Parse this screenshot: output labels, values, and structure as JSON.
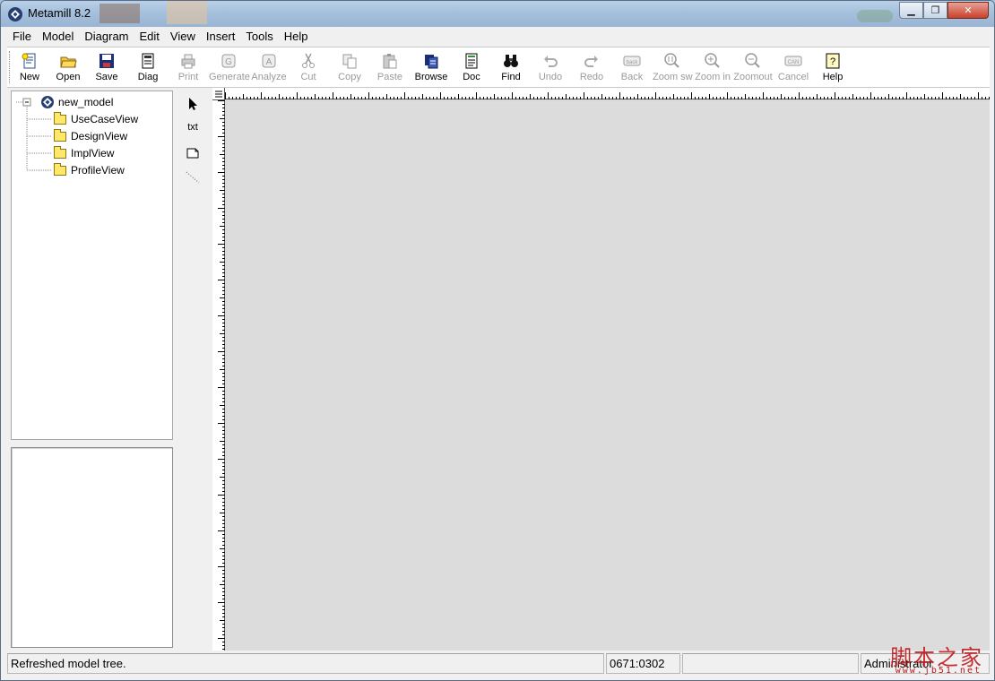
{
  "window": {
    "title": "Metamill 8.2"
  },
  "menu": [
    "File",
    "Model",
    "Diagram",
    "Edit",
    "View",
    "Insert",
    "Tools",
    "Help"
  ],
  "toolbar": [
    {
      "label": "New",
      "icon": "new-document-icon",
      "enabled": true
    },
    {
      "label": "Open",
      "icon": "open-folder-icon",
      "enabled": true
    },
    {
      "label": "Save",
      "icon": "save-disk-icon",
      "enabled": true
    },
    {
      "label": "Diag",
      "icon": "diagram-icon",
      "enabled": true
    },
    {
      "label": "Print",
      "icon": "printer-icon",
      "enabled": false
    },
    {
      "label": "Generate",
      "icon": "generate-icon",
      "enabled": false
    },
    {
      "label": "Analyze",
      "icon": "analyze-icon",
      "enabled": false
    },
    {
      "label": "Cut",
      "icon": "scissors-icon",
      "enabled": false
    },
    {
      "label": "Copy",
      "icon": "copy-icon",
      "enabled": false
    },
    {
      "label": "Paste",
      "icon": "paste-icon",
      "enabled": false
    },
    {
      "label": "Browse",
      "icon": "browse-icon",
      "enabled": true
    },
    {
      "label": "Doc",
      "icon": "document-icon",
      "enabled": true
    },
    {
      "label": "Find",
      "icon": "binoculars-icon",
      "enabled": true
    },
    {
      "label": "Undo",
      "icon": "undo-icon",
      "enabled": false
    },
    {
      "label": "Redo",
      "icon": "redo-icon",
      "enabled": false
    },
    {
      "label": "Back",
      "icon": "back-icon",
      "enabled": false
    },
    {
      "label": "Zoom sw",
      "icon": "zoom-switch-icon",
      "enabled": false
    },
    {
      "label": "Zoom in",
      "icon": "zoom-in-icon",
      "enabled": false
    },
    {
      "label": "Zoomout",
      "icon": "zoom-out-icon",
      "enabled": false
    },
    {
      "label": "Cancel",
      "icon": "cancel-icon",
      "enabled": false
    },
    {
      "label": "Help",
      "icon": "help-icon",
      "enabled": true
    }
  ],
  "tree": {
    "root": "new_model",
    "children": [
      "UseCaseView",
      "DesignView",
      "ImplView",
      "ProfileView"
    ]
  },
  "palette": {
    "text_tool": "txt"
  },
  "status": {
    "message": "Refreshed model tree.",
    "coords": "0671:0302",
    "extra": "",
    "user": "Administrator"
  },
  "watermark": {
    "text": "脚本之家",
    "url": "www.jb51.net"
  }
}
